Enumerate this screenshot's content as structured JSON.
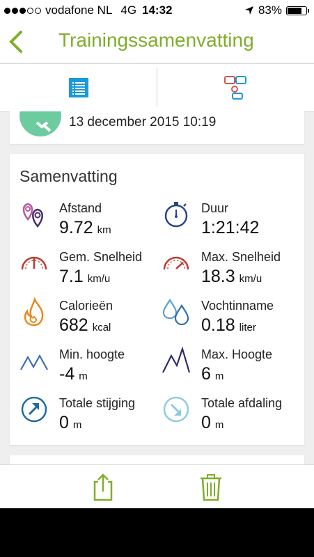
{
  "status_bar": {
    "carrier": "vodafone NL",
    "network": "4G",
    "time": "14:32",
    "battery": "83%",
    "battery_level": 0.83,
    "signal_bars": 3,
    "signal_total": 5
  },
  "navbar": {
    "title": "Trainingssamenvatting",
    "accent_color": "#7fae2b"
  },
  "tabs": [
    {
      "icon": "list-icon",
      "selected": true
    },
    {
      "icon": "comments-icon",
      "selected": false
    }
  ],
  "workout": {
    "date": "13 december 2015 10:19",
    "icon": "running-icon",
    "icon_color": "#6dcba0"
  },
  "summary": {
    "title": "Samenvatting",
    "stats": [
      {
        "label": "Afstand",
        "value": "9.72",
        "unit": "km",
        "icon": "distance-pins-icon"
      },
      {
        "label": "Duur",
        "value": "1:21:42",
        "unit": "",
        "icon": "stopwatch-icon"
      },
      {
        "label": "Gem. Snelheid",
        "value": "7.1",
        "unit": "km/u",
        "icon": "speedometer-avg-icon"
      },
      {
        "label": "Max. Snelheid",
        "value": "18.3",
        "unit": "km/u",
        "icon": "speedometer-max-icon"
      },
      {
        "label": "Calorieën",
        "value": "682",
        "unit": "kcal",
        "icon": "flame-icon"
      },
      {
        "label": "Vochtinname",
        "value": "0.18",
        "unit": "liter",
        "icon": "water-drops-icon"
      },
      {
        "label": "Min. hoogte",
        "value": "-4",
        "unit": "m",
        "icon": "mountain-low-icon"
      },
      {
        "label": "Max. Hoogte",
        "value": "6",
        "unit": "m",
        "icon": "mountain-high-icon"
      },
      {
        "label": "Totale stijging",
        "value": "0",
        "unit": "m",
        "icon": "ascent-arrow-icon"
      },
      {
        "label": "Totale afdaling",
        "value": "0",
        "unit": "m",
        "icon": "descent-arrow-icon"
      }
    ]
  },
  "bottom_bar": {
    "share_icon": "share-icon",
    "delete_icon": "trash-icon"
  }
}
